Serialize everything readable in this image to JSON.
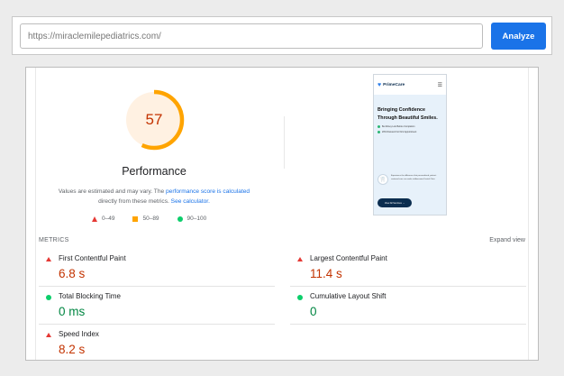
{
  "url_bar": {
    "value": "https://miraclemilepediatrics.com/",
    "analyze_label": "Analyze"
  },
  "performance": {
    "score": "57",
    "score_fraction": 0.57,
    "title": "Performance",
    "note_prefix": "Values are estimated and may vary. The ",
    "note_link1": "performance score is calculated",
    "note_middle": " directly from these metrics. ",
    "note_link2": "See calculator.",
    "legend": {
      "fail": "0–49",
      "average": "50–89",
      "pass": "90–100"
    },
    "colors": {
      "fail": "#e53935",
      "average": "#ffa400",
      "pass": "#0cce6b",
      "gauge_track": "#fff1e2",
      "gauge_arc": "#ffa400",
      "score_text": "#c33300"
    }
  },
  "screenshot": {
    "logo_text": "PrimeCare",
    "logo_icon": "heart-icon",
    "menu_icon": "hamburger-icon",
    "heading": "Bringing Confidence Through Beautiful Smiles.",
    "check1": "Be Money Lost Before Completion",
    "check2": "20% Discount For First Appointment",
    "tooth_icon": "tooth-icon",
    "blurb": "Experience the difference that personalized, patient-centered care can make at Awesome Dental Clinic",
    "cta": "View All Services →"
  },
  "metrics": {
    "header": "METRICS",
    "expand_label": "Expand view",
    "items": [
      {
        "label": "First Contentful Paint",
        "value": "6.8 s",
        "status": "fail"
      },
      {
        "label": "Largest Contentful Paint",
        "value": "11.4 s",
        "status": "fail"
      },
      {
        "label": "Total Blocking Time",
        "value": "0 ms",
        "status": "pass"
      },
      {
        "label": "Cumulative Layout Shift",
        "value": "0",
        "status": "pass"
      },
      {
        "label": "Speed Index",
        "value": "8.2 s",
        "status": "fail"
      }
    ]
  }
}
